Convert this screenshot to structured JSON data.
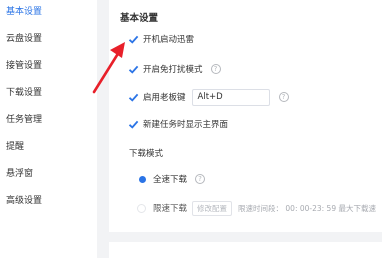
{
  "sidebar": {
    "items": [
      {
        "label": "基本设置"
      },
      {
        "label": "云盘设置"
      },
      {
        "label": "接管设置"
      },
      {
        "label": "下载设置"
      },
      {
        "label": "任务管理"
      },
      {
        "label": "提醒"
      },
      {
        "label": "悬浮窗"
      },
      {
        "label": "高级设置"
      }
    ]
  },
  "main": {
    "section_title": "基本设置",
    "options": [
      {
        "label": "开机启动迅雷",
        "checked": true
      },
      {
        "label": "开启免打扰模式",
        "checked": true
      },
      {
        "label": "启用老板键",
        "checked": true
      },
      {
        "label": "新建任务时显示主界面",
        "checked": true
      }
    ],
    "boss_key_value": "Alt+D",
    "help_glyph": "?",
    "download_mode_title": "下载模式",
    "full_speed_label": "全速下载",
    "limit_speed_label": "限速下载",
    "modify_config_label": "修改配置",
    "limit_period_text": "限速时间段： 00: 00-23: 59  最大下载速"
  },
  "colors": {
    "accent": "#2b74e6",
    "arrow": "#e8202a",
    "sidebar_active": "#2b74e6"
  },
  "icons": [
    "checkbox-checked-icon",
    "help-circle-icon",
    "radio-selected-icon",
    "radio-unselected-icon",
    "red-arrow-annotation"
  ]
}
